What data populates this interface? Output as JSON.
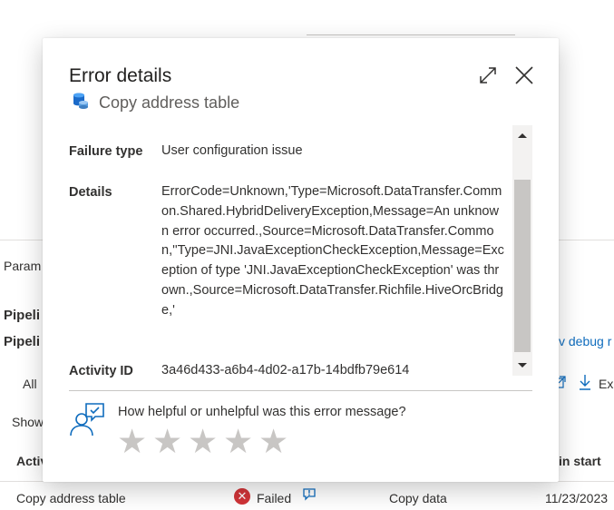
{
  "background": {
    "tab_fragment": "Param",
    "pipeline_label_1": "Pipeli",
    "pipeline_label_2": "Pipeli",
    "filter_all": "All",
    "show_label": "Show",
    "debug_link": "v debug r",
    "export_label": "Ex",
    "col_activity": "Activ",
    "col_run_start": "in start",
    "row": {
      "name": "Copy address table",
      "status": "Failed",
      "type": "Copy data",
      "date": "11/23/2023"
    }
  },
  "dialog": {
    "title": "Error details",
    "subtitle": "Copy address table",
    "fields": {
      "failure_type_label": "Failure type",
      "failure_type_value": "User configuration issue",
      "details_label": "Details",
      "details_value": "ErrorCode=Unknown,'Type=Microsoft.DataTransfer.Common.Shared.HybridDeliveryException,Message=An unknown error occurred.,Source=Microsoft.DataTransfer.Common,''Type=JNI.JavaExceptionCheckException,Message=Exception of type 'JNI.JavaExceptionCheckException' was thrown.,Source=Microsoft.DataTransfer.Richfile.HiveOrcBridge,'",
      "activity_id_label": "Activity ID",
      "activity_id_value": "3a46d433-a6b4-4d02-a17b-14bdfb79e614"
    },
    "feedback": {
      "question": "How helpful or unhelpful was this error message?",
      "stars": [
        "★",
        "★",
        "★",
        "★",
        "★"
      ]
    }
  },
  "colors": {
    "accent": "#0f6cbd",
    "error": "#d13438",
    "star_empty": "#c8c6c4"
  },
  "icons": [
    "database-icon",
    "expand-icon",
    "close-icon",
    "feedback-person-icon",
    "star-icon",
    "error-icon",
    "chat-bubble-icon",
    "download-icon"
  ]
}
